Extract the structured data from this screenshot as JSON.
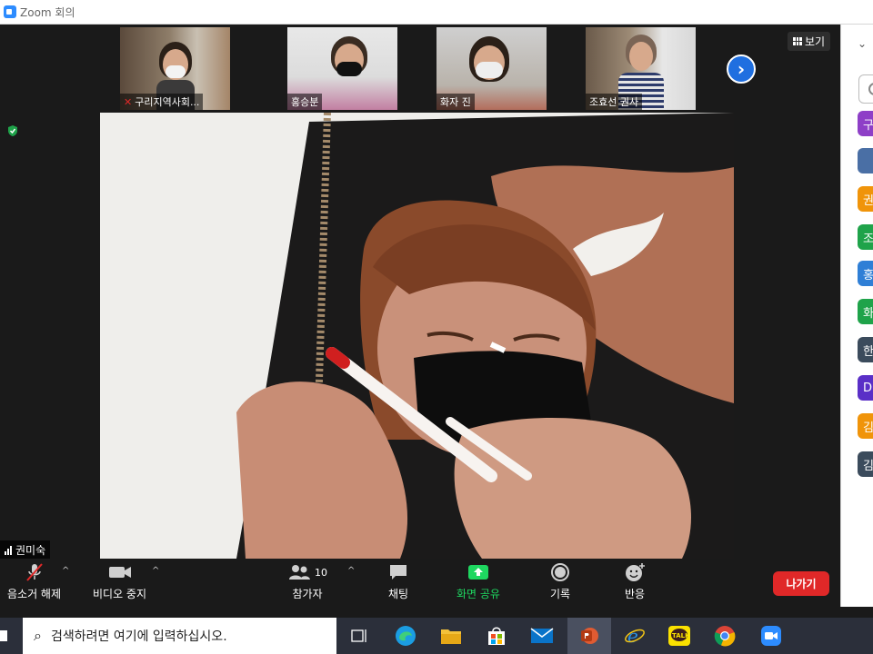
{
  "window": {
    "title": "Zoom 회의"
  },
  "thumbnails": [
    {
      "name": "구리지역사회...",
      "muted": true
    },
    {
      "name": "홍승분",
      "muted": false
    },
    {
      "name": "화자 진",
      "muted": false
    },
    {
      "name": "조효선 권사",
      "muted": false
    }
  ],
  "view_button": {
    "label": "보기"
  },
  "speaker": {
    "name": "권미숙"
  },
  "toolbar": {
    "mute_label": "음소거 해제",
    "video_label": "비디오 중지",
    "participants_label": "참가자",
    "participants_count": "10",
    "chat_label": "채팅",
    "share_label": "화면 공유",
    "record_label": "기록",
    "reactions_label": "반응",
    "leave_label": "나가기"
  },
  "panel": {
    "participants": [
      {
        "initial": "구",
        "color": "#8e3fc7"
      },
      {
        "initial": "",
        "color": "#4a6fa5"
      },
      {
        "initial": "권",
        "color": "#f0940a"
      },
      {
        "initial": "조",
        "color": "#1fa34a"
      },
      {
        "initial": "홍",
        "color": "#2f7fd6"
      },
      {
        "initial": "화",
        "color": "#1fa34a"
      },
      {
        "initial": "한",
        "color": "#3b4b5c"
      },
      {
        "initial": "DI",
        "color": "#5a2fc7"
      },
      {
        "initial": "김",
        "color": "#f0940a"
      },
      {
        "initial": "김",
        "color": "#3b4b5c"
      }
    ]
  },
  "taskbar": {
    "search_placeholder": "검색하려면 여기에 입력하십시오.",
    "kakao_label": "TALK"
  },
  "colors": {
    "accent": "#2d8cff",
    "leave": "#e02828",
    "share": "#1ed760"
  }
}
